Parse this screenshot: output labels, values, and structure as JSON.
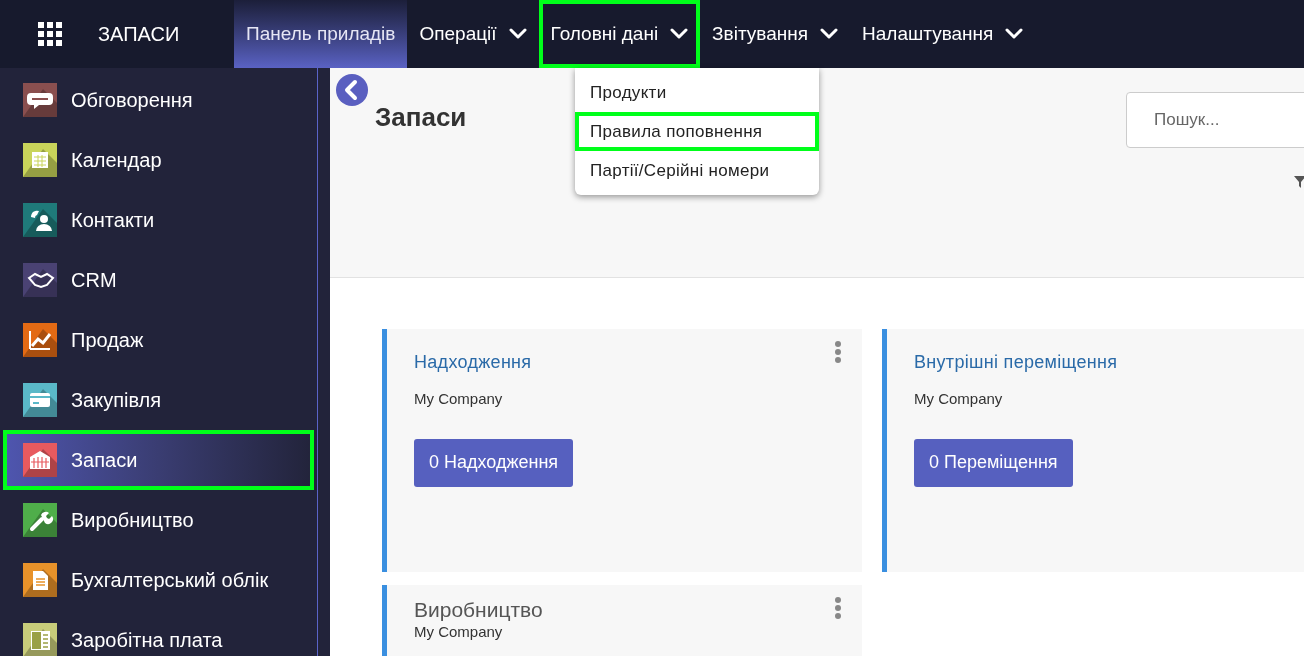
{
  "topbar": {
    "app_title": "ЗАПАСИ",
    "menu": [
      {
        "label": "Панель приладів",
        "selected": true,
        "has_caret": false,
        "highlighted": false
      },
      {
        "label": "Операції",
        "selected": false,
        "has_caret": true,
        "highlighted": false
      },
      {
        "label": "Головні дані",
        "selected": false,
        "has_caret": true,
        "highlighted": true
      },
      {
        "label": "Звітування",
        "selected": false,
        "has_caret": true,
        "highlighted": false
      },
      {
        "label": "Налаштування",
        "selected": false,
        "has_caret": true,
        "highlighted": false
      }
    ]
  },
  "dropdown": {
    "items": [
      {
        "label": "Продукти",
        "highlighted": false
      },
      {
        "label": "Правила поповнення",
        "highlighted": true
      },
      {
        "label": "Партії/Серійні номери",
        "highlighted": false
      }
    ]
  },
  "sidebar": {
    "items": [
      {
        "label": "Обговорення",
        "kind": "chat",
        "color": "#8a4f4f",
        "selected": false,
        "highlighted": false
      },
      {
        "label": "Календар",
        "kind": "calendar",
        "color": "#c9d45a",
        "selected": false,
        "highlighted": false
      },
      {
        "label": "Контакти",
        "kind": "contacts",
        "color": "#1f7a7a",
        "selected": false,
        "highlighted": false
      },
      {
        "label": "CRM",
        "kind": "handshake",
        "color": "#4a4273",
        "selected": false,
        "highlighted": false
      },
      {
        "label": "Продаж",
        "kind": "chart",
        "color": "#e36a14",
        "selected": false,
        "highlighted": false
      },
      {
        "label": "Закупівля",
        "kind": "card",
        "color": "#5ab8c8",
        "selected": false,
        "highlighted": false
      },
      {
        "label": "Запаси",
        "kind": "warehouse",
        "color": "#e85a5f",
        "selected": true,
        "highlighted": true
      },
      {
        "label": "Виробництво",
        "kind": "wrench",
        "color": "#4fae4a",
        "selected": false,
        "highlighted": false
      },
      {
        "label": "Бухгалтерський облік",
        "kind": "document",
        "color": "#e8922a",
        "selected": false,
        "highlighted": false
      },
      {
        "label": "Заробітна плата",
        "kind": "payroll",
        "color": "#c8cc7a",
        "selected": false,
        "highlighted": false
      }
    ]
  },
  "page": {
    "title": "Запаси",
    "search": {
      "placeholder": "Пошук..."
    }
  },
  "cards": [
    {
      "title": "Надходження",
      "company": "My Company",
      "button": "0 Надходження",
      "has_menu": true
    },
    {
      "title": "Внутрішні переміщення",
      "company": "My Company",
      "button": "0 Переміщення",
      "has_menu": false
    },
    {
      "title": "Виробництво",
      "company": "My Company",
      "has_menu": true
    }
  ]
}
